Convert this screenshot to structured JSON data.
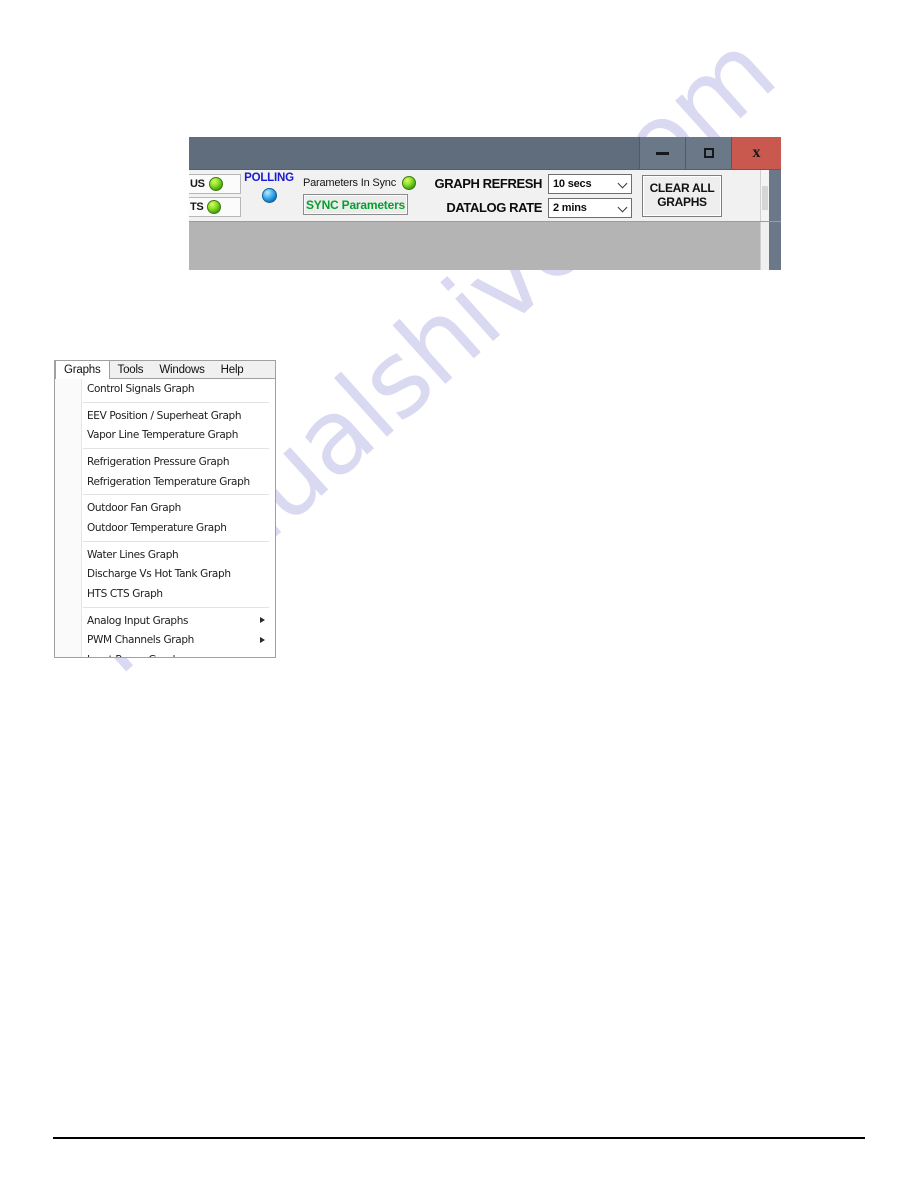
{
  "page": {
    "watermark": "manualshive.com"
  },
  "app_window": {
    "titlebar": {
      "minimize_label": "Minimize",
      "maximize_label": "Maximize",
      "close_label": "x"
    },
    "toolbar": {
      "status_items": [
        {
          "label": "US",
          "led": "green-led",
          "led_color": "#8ee02a"
        },
        {
          "label": "TS",
          "led": "green-led",
          "led_color": "#8ee02a"
        }
      ],
      "polling": {
        "label": "POLLING",
        "label_color": "#1a1ad0",
        "led": "blue-led",
        "led_color": "#49b6ef"
      },
      "sync": {
        "status_label": "Parameters In Sync",
        "status_led": "green-led",
        "button_label": "SYNC Parameters",
        "button_color": "#089e2f"
      },
      "graph_refresh": {
        "label": "GRAPH REFRESH",
        "value": "10 secs"
      },
      "datalog_rate": {
        "label": "DATALOG RATE",
        "value": "2 mins"
      },
      "clear_all": {
        "line1": "CLEAR ALL",
        "line2": "GRAPHS"
      }
    }
  },
  "menu_window": {
    "menubar": [
      {
        "label": "Graphs",
        "active": true
      },
      {
        "label": "Tools",
        "active": false
      },
      {
        "label": "Windows",
        "active": false
      },
      {
        "label": "Help",
        "active": false
      }
    ],
    "dropdown_groups": [
      {
        "items": [
          {
            "label": "Control Signals Graph",
            "submenu": false
          }
        ]
      },
      {
        "items": [
          {
            "label": "EEV Position / Superheat Graph",
            "submenu": false
          },
          {
            "label": "Vapor Line Temperature Graph",
            "submenu": false
          }
        ]
      },
      {
        "items": [
          {
            "label": "Refrigeration Pressure Graph",
            "submenu": false
          },
          {
            "label": "Refrigeration Temperature Graph",
            "submenu": false
          }
        ]
      },
      {
        "items": [
          {
            "label": "Outdoor Fan Graph",
            "submenu": false
          },
          {
            "label": "Outdoor Temperature Graph",
            "submenu": false
          }
        ]
      },
      {
        "items": [
          {
            "label": "Water Lines Graph",
            "submenu": false
          },
          {
            "label": "Discharge Vs Hot Tank Graph",
            "submenu": false
          },
          {
            "label": "HTS CTS Graph",
            "submenu": false
          }
        ]
      },
      {
        "items": [
          {
            "label": "Analog Input Graphs",
            "submenu": true
          },
          {
            "label": "PWM Channels Graph",
            "submenu": true
          },
          {
            "label": "Input Power Graph",
            "submenu": false
          }
        ]
      }
    ]
  }
}
